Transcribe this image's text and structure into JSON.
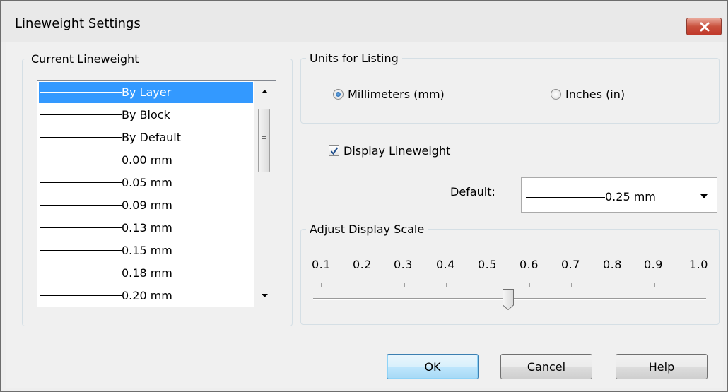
{
  "window": {
    "title": "Lineweight Settings",
    "close_icon": "close-x-icon",
    "close_color": "#c7422e"
  },
  "current_lineweight": {
    "legend": "Current Lineweight",
    "items": [
      {
        "label": "By Layer",
        "selected": true
      },
      {
        "label": "By Block",
        "selected": false
      },
      {
        "label": "By Default",
        "selected": false
      },
      {
        "label": "0.00 mm",
        "selected": false
      },
      {
        "label": "0.05 mm",
        "selected": false
      },
      {
        "label": "0.09 mm",
        "selected": false
      },
      {
        "label": "0.13 mm",
        "selected": false
      },
      {
        "label": "0.15 mm",
        "selected": false
      },
      {
        "label": "0.18 mm",
        "selected": false
      },
      {
        "label": "0.20 mm",
        "selected": false
      }
    ],
    "selection_color": "#3399ff"
  },
  "units": {
    "legend": "Units for Listing",
    "options": [
      {
        "label": "Millimeters (mm)",
        "checked": true
      },
      {
        "label": "Inches (in)",
        "checked": false
      }
    ]
  },
  "display_lineweight": {
    "label": "Display Lineweight",
    "checked": true
  },
  "default": {
    "label": "Default:",
    "value": "0.25 mm"
  },
  "scale": {
    "legend": "Adjust Display Scale",
    "ticks": [
      "0.1",
      "0.2",
      "0.3",
      "0.4",
      "0.5",
      "0.6",
      "0.7",
      "0.8",
      "0.9",
      "1.0"
    ],
    "value": "0.55"
  },
  "buttons": {
    "ok": "OK",
    "cancel": "Cancel",
    "help": "Help"
  }
}
